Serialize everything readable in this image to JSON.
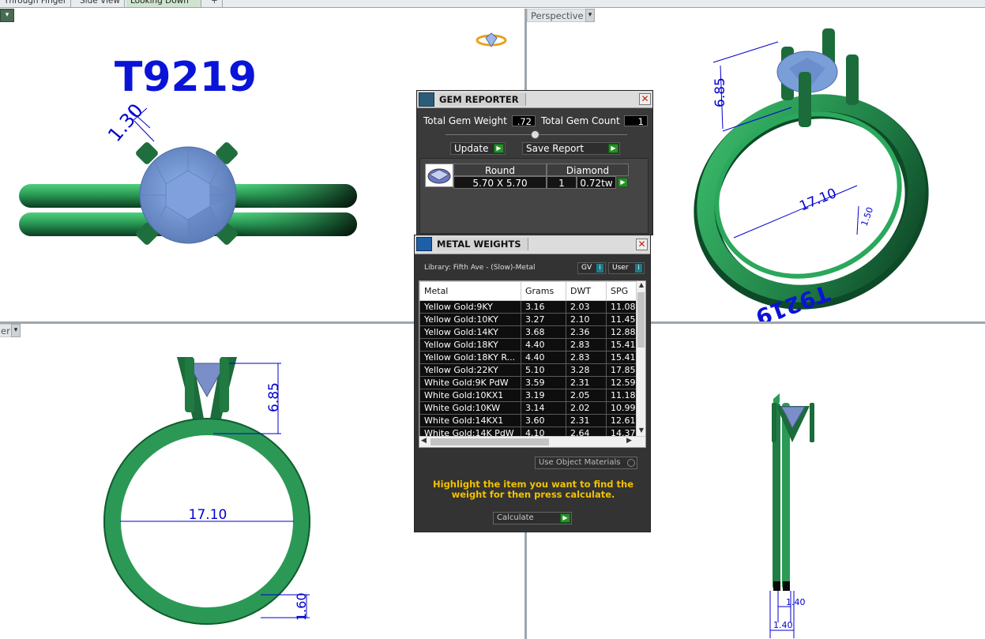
{
  "tabs": [
    "Through Finger",
    "Side View",
    "Looking Down",
    "+"
  ],
  "viewports": {
    "top_right_label": "Perspective",
    "bottom_left_label": "er",
    "dropdown_glyph": "▾"
  },
  "annotations": {
    "stock_number": "T9219",
    "mirrored_stock_number": "T9219",
    "dim_prong": "1.30",
    "dim_height": "6.85",
    "dim_diameter": "17.10",
    "dim_band": "1.30",
    "dim_band_width": "1.60",
    "dim_side_a": "1.40",
    "dim_side_b": "1.40",
    "persp_small_dim": "1.50"
  },
  "gem_reporter": {
    "title": "GEM REPORTER",
    "close": "✕",
    "total_weight_label": "Total Gem Weight",
    "total_weight_value": ".72",
    "total_count_label": "Total Gem Count",
    "total_count_value": "1",
    "update_label": "Update",
    "save_report_label": "Save Report",
    "gem_row": {
      "shape": "Round",
      "size": "5.70 X 5.70",
      "type": "Diamond",
      "count": "1",
      "weight": "0.72tw"
    }
  },
  "metal_weights": {
    "title": "METAL WEIGHTS",
    "close": "✕",
    "library": "Library: Fifth Ave - (Slow)-Metal",
    "gv_label": "GV",
    "user_label": "User",
    "columns": [
      "Metal",
      "Grams",
      "DWT",
      "SPG"
    ],
    "rows": [
      [
        "Yellow Gold:9KY",
        "3.16",
        "2.03",
        "11.08"
      ],
      [
        "Yellow Gold:10KY",
        "3.27",
        "2.10",
        "11.45"
      ],
      [
        "Yellow Gold:14KY",
        "3.68",
        "2.36",
        "12.88"
      ],
      [
        "Yellow Gold:18KY",
        "4.40",
        "2.83",
        "15.41"
      ],
      [
        "Yellow Gold:18KY R...",
        "4.40",
        "2.83",
        "15.41"
      ],
      [
        "Yellow Gold:22KY",
        "5.10",
        "3.28",
        "17.85"
      ],
      [
        "White Gold:9K PdW",
        "3.59",
        "2.31",
        "12.59"
      ],
      [
        "White Gold:10KX1",
        "3.19",
        "2.05",
        "11.18"
      ],
      [
        "White Gold:10KW",
        "3.14",
        "2.02",
        "10.99"
      ],
      [
        "White Gold:14KX1",
        "3.60",
        "2.31",
        "12.61"
      ],
      [
        "White Gold:14K PdW",
        "4.10",
        "2.64",
        "14.37"
      ]
    ],
    "use_object_materials": "Use Object Materials",
    "instruction": "Highlight the item you want to find the weight for then press calculate.",
    "calculate_label": "Calculate"
  },
  "colors": {
    "ring_green": "#2e9b58",
    "ring_dark": "#0b3d22",
    "gem_blue": "#7a9fd8",
    "dimension_blue": "#0000d0",
    "title_blue": "#0a14d8",
    "dialog_bg": "#3a3a3a",
    "instruction_yellow": "#f2c200"
  }
}
